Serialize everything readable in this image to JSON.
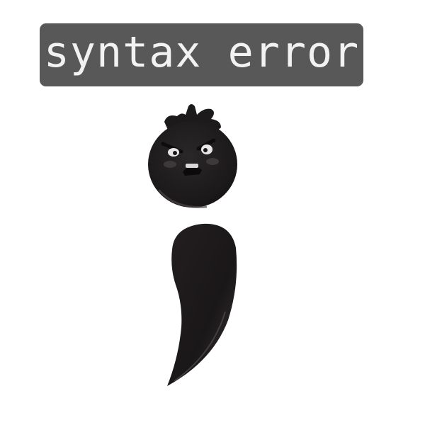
{
  "label": {
    "text": "syntax error",
    "background_color": "#585858",
    "text_color": "#f2f2f2"
  },
  "illustration": {
    "subject": "angry-semicolon-character",
    "body_color": "#1c1a1b"
  }
}
